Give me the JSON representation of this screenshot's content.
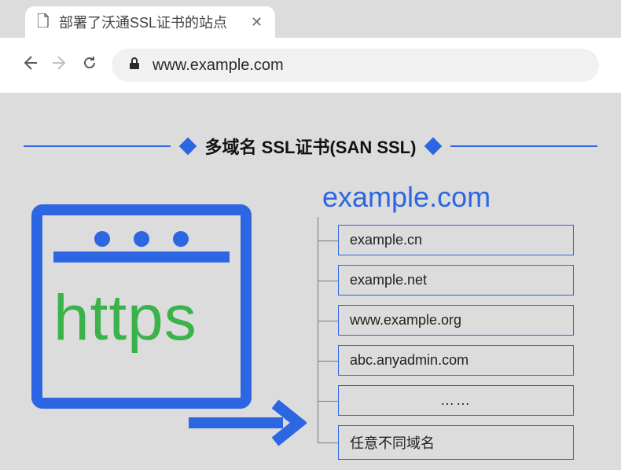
{
  "browser": {
    "tab_title": "部署了沃通SSL证书的站点",
    "url": "www.example.com"
  },
  "title": "多域名 SSL证书(SAN SSL)",
  "https_label": "https",
  "tree": {
    "root": "example.com",
    "items": [
      "example.cn",
      "example.net",
      "www.example.org",
      "abc.anyadmin.com",
      "……",
      "任意不同域名"
    ]
  },
  "colors": {
    "accent": "#2c66e3",
    "green": "#3bb24a",
    "bg": "#dcdcdc"
  }
}
